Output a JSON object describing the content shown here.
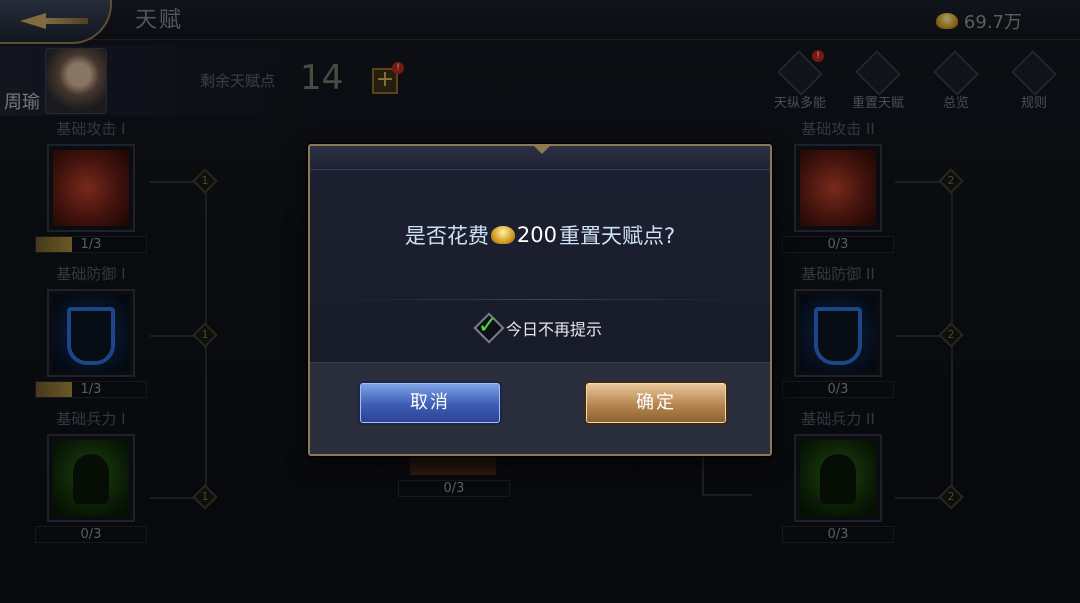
{
  "header": {
    "title": "天赋",
    "gold": "69.7万"
  },
  "hero": {
    "name": "周瑜",
    "talent_points_label": "剩余天赋点",
    "talent_points_value": "14",
    "add_badge": "!"
  },
  "tools": [
    {
      "label": "天纵多能",
      "icon": "multi-talent-icon",
      "badge": "!"
    },
    {
      "label": "重置天赋",
      "icon": "reset-icon"
    },
    {
      "label": "总览",
      "icon": "overview-icon"
    },
    {
      "label": "规则",
      "icon": "rules-icon"
    }
  ],
  "left_tree": [
    {
      "name": "基础攻击 I",
      "progress": "1/3",
      "fill": 0.33
    },
    {
      "name": "基础防御 I",
      "progress": "1/3",
      "fill": 0.33
    },
    {
      "name": "基础兵力 I",
      "progress": "0/3",
      "fill": 0
    }
  ],
  "right_tree": [
    {
      "name": "基础攻击 II",
      "progress": "0/3",
      "fill": 0
    },
    {
      "name": "基础防御 II",
      "progress": "0/3",
      "fill": 0
    },
    {
      "name": "基础兵力 II",
      "progress": "0/3",
      "fill": 0
    }
  ],
  "middle_progress": "0/3",
  "nodes": {
    "left": [
      "1",
      "1",
      "1"
    ],
    "right": [
      "2",
      "2",
      "2"
    ]
  },
  "dialog": {
    "message_prefix": "是否花费",
    "cost": "200",
    "message_suffix": "重置天赋点?",
    "checkbox_label": "今日不再提示",
    "checked": true,
    "cancel_label": "取消",
    "confirm_label": "确定"
  },
  "colors": {
    "cancel_button": "#3d5cb3",
    "confirm_button": "#b58550",
    "frame_gold": "#8d7a54",
    "check_green": "#4ade3a"
  }
}
